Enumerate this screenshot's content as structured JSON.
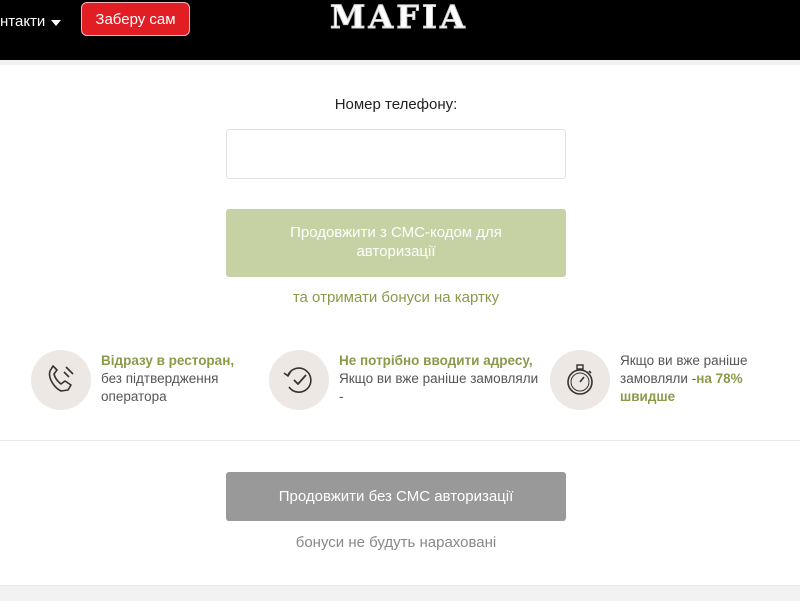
{
  "header": {
    "contacts_label": "нтакти",
    "pickup_label": "Заберу сам",
    "logo_text": "MAFIA"
  },
  "auth": {
    "phone_label": "Номер телефону:",
    "phone_value": "",
    "sms_button_label": "Продовжити з СМС-кодом для авторизації",
    "bonus_note": "та отримати бонуси на картку"
  },
  "features": [
    {
      "icon": "phone-icon",
      "highlight": "Відразу в ресторан,",
      "text": " без підтвердження оператора"
    },
    {
      "icon": "clock-check-icon",
      "highlight": "Не потрібно вводити адресу,",
      "text": " Якщо ви вже раніше замовляли -"
    },
    {
      "icon": "stopwatch-icon",
      "text": "Якщо ви вже раніше замовляли -",
      "highlight": "на 78% швидше"
    }
  ],
  "no_sms": {
    "button_label": "Продовжити без СМС авторизації",
    "note": "бонуси не будуть нараховані"
  },
  "colors": {
    "header_bg": "#000000",
    "pickup_red": "#e01e24",
    "sms_green": "#c7d2a4",
    "accent_olive": "#8a9a4b",
    "grey_button": "#999999"
  }
}
